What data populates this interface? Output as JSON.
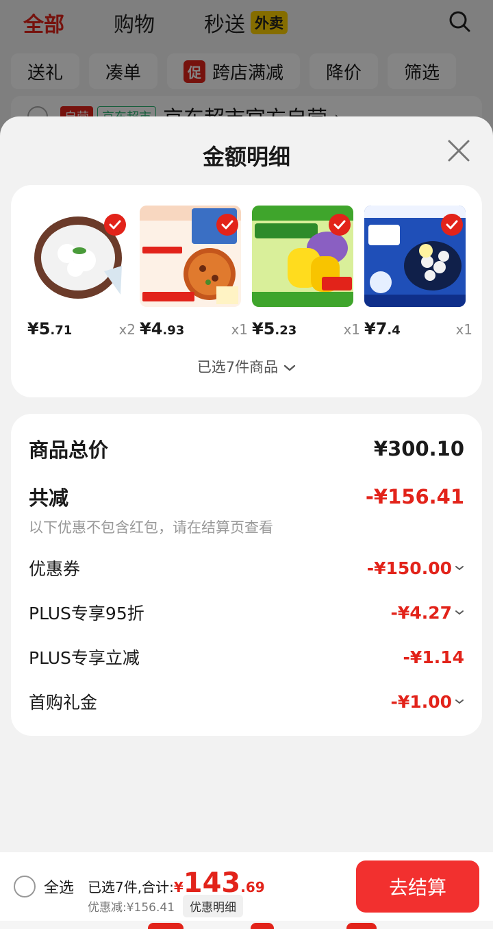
{
  "background": {
    "tabs": [
      {
        "label": "全部",
        "active": true
      },
      {
        "label": "购物",
        "active": false
      },
      {
        "label": "秒送",
        "active": false,
        "badge": "外卖"
      }
    ],
    "chips": [
      "送礼",
      "凑单",
      "跨店满减",
      "降价",
      "筛选"
    ],
    "promo_chip_tag": "促",
    "store": {
      "tag_self": "自营",
      "tag_channel": "京东超市",
      "name": "京东超市官方自营 ›"
    }
  },
  "sheet": {
    "title": "金额明细",
    "products": [
      {
        "price_int": "¥5",
        "price_dec": ".71",
        "qty": "x2"
      },
      {
        "price_int": "¥4",
        "price_dec": ".93",
        "qty": "x1"
      },
      {
        "price_int": "¥5",
        "price_dec": ".23",
        "qty": "x1"
      },
      {
        "price_int": "¥7",
        "price_dec": ".4",
        "qty": "x1"
      }
    ],
    "selected_count_label": "已选7件商品",
    "details": {
      "total_label": "商品总价",
      "total_value": "¥300.10",
      "reduce_label": "共减",
      "reduce_value": "-¥156.41",
      "note": "以下优惠不包含红包，请在结算页查看",
      "items": [
        {
          "label": "优惠券",
          "value": "-¥150.00",
          "expandable": true
        },
        {
          "label": "PLUS专享95折",
          "value": "-¥4.27",
          "expandable": true
        },
        {
          "label": "PLUS专享立减",
          "value": "-¥1.14",
          "expandable": false
        },
        {
          "label": "首购礼金",
          "value": "-¥1.00",
          "expandable": true
        }
      ]
    }
  },
  "bottom_bar": {
    "select_all": "全选",
    "summary_label": "已选7件,合计:",
    "currency": "¥",
    "total_int": "143",
    "total_dec": ".69",
    "discount_label": "优惠减:¥156.41",
    "discount_detail_button": "优惠明细",
    "checkout_button": "去结算"
  },
  "colors": {
    "accent": "#e2231a",
    "checkout": "#f2302f"
  }
}
